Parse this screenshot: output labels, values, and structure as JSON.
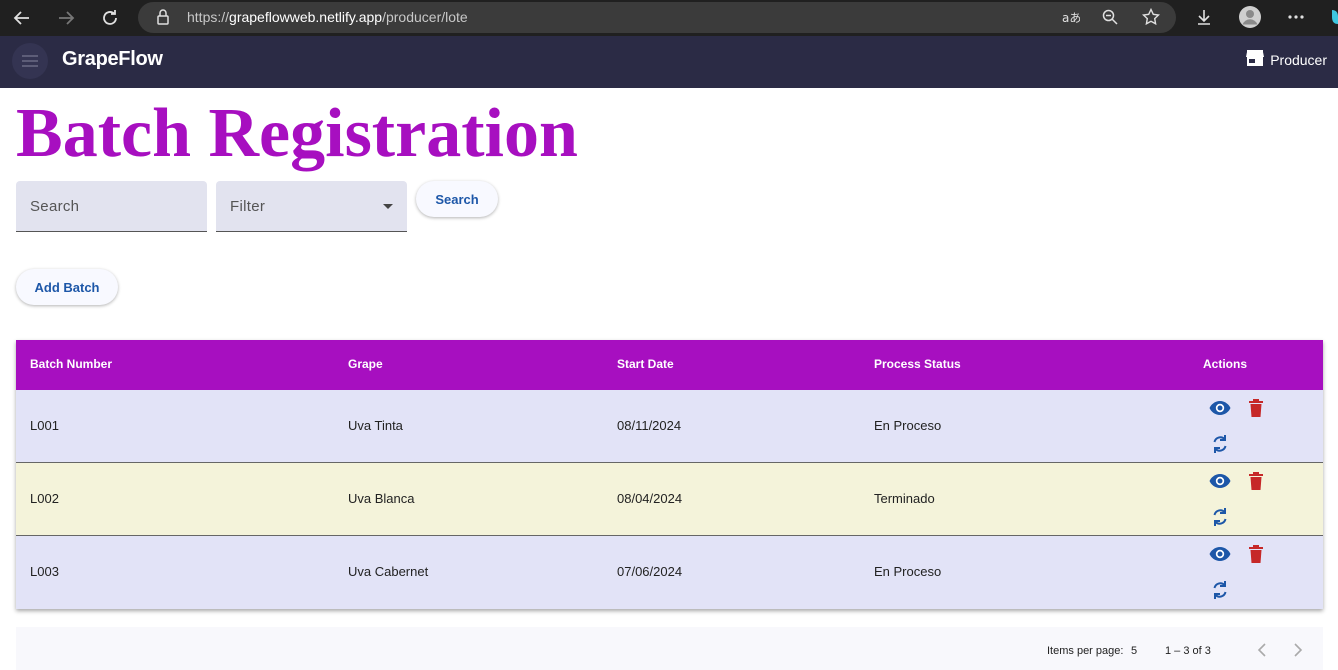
{
  "browser": {
    "url_prefix": "https://",
    "url_host": "grapeflowweb.netlify.app",
    "url_path": "/producer/lote"
  },
  "toolbar": {
    "brand": "GrapeFlow",
    "user_role": "Producer"
  },
  "page": {
    "title": "Batch Registration"
  },
  "search": {
    "placeholder": "Search",
    "filter_label": "Filter",
    "button_label": "Search"
  },
  "add_button_label": "Add Batch",
  "table": {
    "headers": [
      "Batch Number",
      "Grape",
      "Start Date",
      "Process Status",
      "Actions"
    ],
    "rows": [
      {
        "batch": "L001",
        "grape": "Uva Tinta",
        "start_date": "08/11/2024",
        "status": "En Proceso",
        "bg": "#e2e3f7"
      },
      {
        "batch": "L002",
        "grape": "Uva Blanca",
        "start_date": "08/04/2024",
        "status": "Terminado",
        "bg": "#f4f3da"
      },
      {
        "batch": "L003",
        "grape": "Uva Cabernet",
        "start_date": "07/06/2024",
        "status": "En Proceso",
        "bg": "#e2e3f7"
      }
    ]
  },
  "paginator": {
    "items_per_page_label": "Items per page:",
    "items_per_page": "5",
    "range": "1 – 3 of 3"
  },
  "colors": {
    "accent": "#a70fc0",
    "toolbar": "#2b2b45",
    "action_blue": "#1d57a8",
    "action_red": "#c62828"
  }
}
